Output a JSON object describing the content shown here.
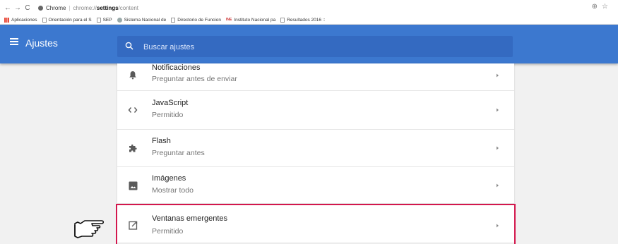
{
  "addressbar": {
    "back": "←",
    "forward": "→",
    "reload": "C",
    "chrome_label": "Chrome",
    "separator": "|",
    "url_host": "chrome://",
    "url_path": "settings",
    "url_tail": "/content",
    "zoom_icon": "⊕",
    "star_icon": "☆"
  },
  "bookmarks": [
    {
      "label": "Aplicaciones",
      "icon": "apps-icon"
    },
    {
      "label": "Orientación para el S",
      "icon": "page-icon"
    },
    {
      "label": "SEP",
      "icon": "page-icon"
    },
    {
      "label": "Sistema Nacional de",
      "icon": "globe-icon"
    },
    {
      "label": "Directorio de Funcion",
      "icon": "page-icon"
    },
    {
      "label": "Instituto Nacional pa",
      "icon": "ine-logo",
      "badge": "INE"
    },
    {
      "label": "Resultados 2016 ::",
      "icon": "page-icon"
    }
  ],
  "header": {
    "title": "Ajustes",
    "search_placeholder": "Buscar ajustes",
    "color": "#3c78cf"
  },
  "settings_rows": [
    {
      "title": "Notificaciones",
      "subtitle": "Preguntar antes de enviar",
      "icon": "bell-icon"
    },
    {
      "title": "JavaScript",
      "subtitle": "Permitido",
      "icon": "code-icon"
    },
    {
      "title": "Flash",
      "subtitle": "Preguntar antes",
      "icon": "puzzle-icon"
    },
    {
      "title": "Imágenes",
      "subtitle": "Mostrar todo",
      "icon": "image-icon"
    },
    {
      "title": "Ventanas emergentes",
      "subtitle": "Permitido",
      "icon": "popup-icon",
      "highlighted": true
    }
  ],
  "highlight_color": "#d3174d"
}
